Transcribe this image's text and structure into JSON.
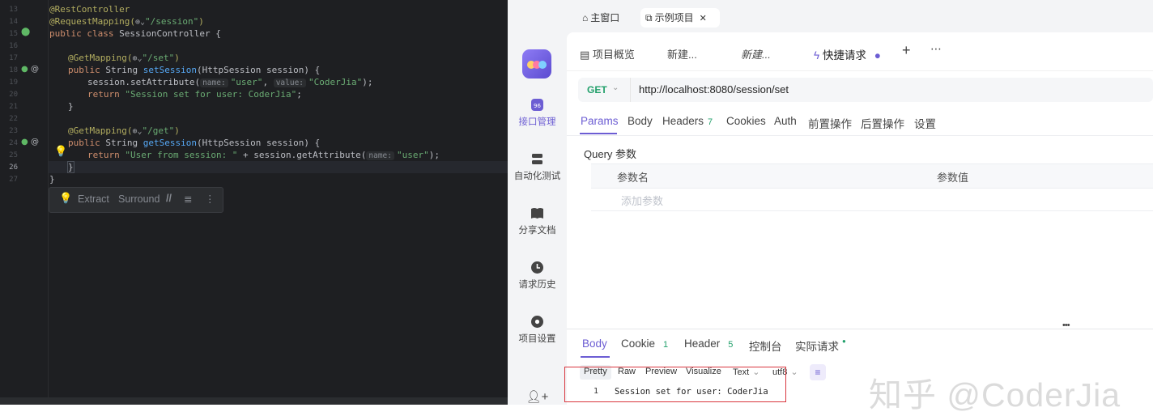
{
  "editor": {
    "gutter": [
      "13",
      "14",
      "15",
      "16",
      "17",
      "18",
      "19",
      "20",
      "21",
      "22",
      "23",
      "24",
      "25",
      "26",
      "27"
    ],
    "lines": {
      "l13": "@RestController",
      "l14_ann": "@RequestMapping(",
      "l14_str": "\"/session\"",
      "l14_end": ")",
      "l15_kw": "public class ",
      "l15_rest": "SessionController {",
      "l17_ann": "@GetMapping(",
      "l17_str": "\"/set\"",
      "l17_end": ")",
      "l18_kw": "public ",
      "l18_type": "String ",
      "l18_fn": "setSession",
      "l18_rest": "(HttpSession session) {",
      "l19_pre": "session.setAttribute(",
      "l19_hint1": "name:",
      "l19_str1": "\"user\"",
      "l19_comma": ", ",
      "l19_hint2": "value:",
      "l19_str2": "\"CoderJia\"",
      "l19_end": ");",
      "l20_kw": "return ",
      "l20_str": "\"Session set for user: CoderJia\"",
      "l20_end": ";",
      "l21": "}",
      "l23_ann": "@GetMapping(",
      "l23_str": "\"/get\"",
      "l23_end": ")",
      "l24_kw": "public ",
      "l24_type": "String ",
      "l24_fn": "getSession",
      "l24_rest": "(HttpSession session) {",
      "l25_kw": "return ",
      "l25_str": "\"User from session: \"",
      "l25_mid": " + session.getAttribute(",
      "l25_hint": "name:",
      "l25_str2": "\"user\"",
      "l25_end": ");",
      "l26": "}",
      "l27": "}"
    },
    "popup": {
      "extract": "Extract",
      "surround": "Surround"
    }
  },
  "app": {
    "window_tabs": [
      "主窗口",
      "示例项目"
    ],
    "sidebar": [
      "接口管理",
      "自动化测试",
      "分享文档",
      "请求历史",
      "项目设置"
    ],
    "doc_tabs": [
      "项目概览",
      "新建...",
      "新建...",
      "快捷请求"
    ],
    "method": "GET",
    "url": "http://localhost:8080/session/set",
    "req_tabs": {
      "params": "Params",
      "body": "Body",
      "headers": "Headers",
      "headers_count": "7",
      "cookies": "Cookies",
      "auth": "Auth",
      "pre": "前置操作",
      "post": "后置操作",
      "settings": "设置"
    },
    "query_title": "Query 参数",
    "table_headers": [
      "参数名",
      "参数值"
    ],
    "add_param": "添加参数",
    "resp_tabs": {
      "body": "Body",
      "cookie": "Cookie",
      "cookie_count": "1",
      "header": "Header",
      "header_count": "5",
      "console": "控制台",
      "actual": "实际请求"
    },
    "resp_modes": [
      "Pretty",
      "Raw",
      "Preview",
      "Visualize",
      "Text",
      "utf8"
    ],
    "resp_line_no": "1",
    "resp_body": "Session set for user: CoderJia",
    "watermark": "知乎 @CoderJia"
  },
  "colors": {
    "accent": "#6c5dd3",
    "green": "#22a06b",
    "highlight_box": "#d9363e"
  }
}
